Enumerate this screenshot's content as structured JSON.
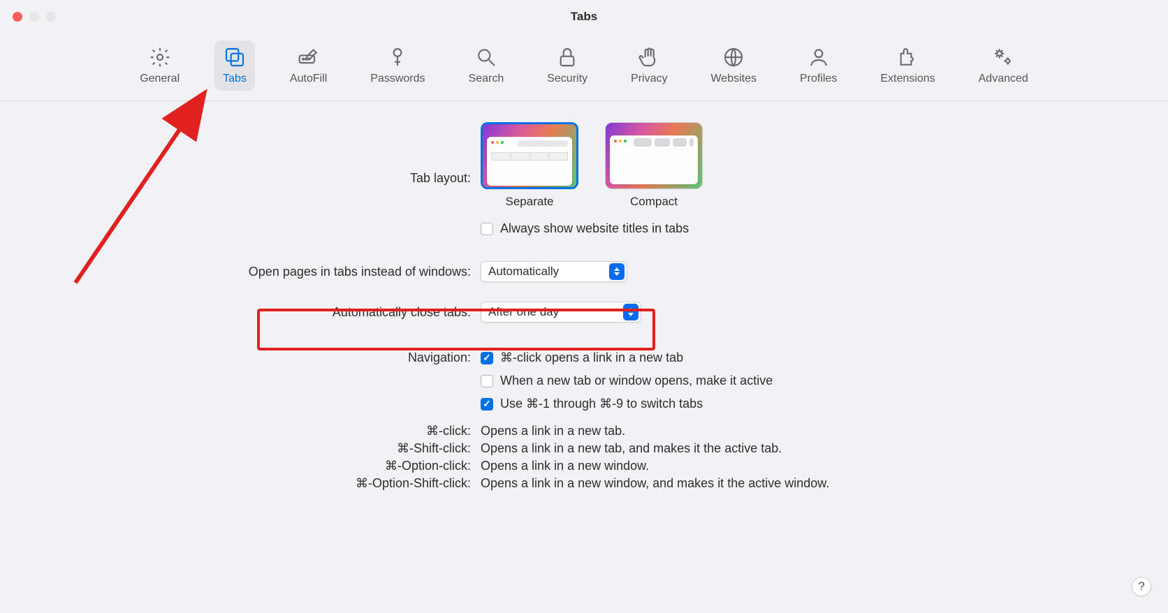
{
  "window": {
    "title": "Tabs"
  },
  "toolbar": {
    "items": [
      {
        "label": "General"
      },
      {
        "label": "Tabs",
        "selected": true
      },
      {
        "label": "AutoFill"
      },
      {
        "label": "Passwords"
      },
      {
        "label": "Search"
      },
      {
        "label": "Security"
      },
      {
        "label": "Privacy"
      },
      {
        "label": "Websites"
      },
      {
        "label": "Profiles"
      },
      {
        "label": "Extensions"
      },
      {
        "label": "Advanced"
      }
    ]
  },
  "tabLayout": {
    "label": "Tab layout:",
    "options": {
      "separate": "Separate",
      "compact": "Compact"
    },
    "alwaysShowTitles": {
      "label": "Always show website titles in tabs",
      "checked": false
    }
  },
  "openPages": {
    "label": "Open pages in tabs instead of windows:",
    "value": "Automatically"
  },
  "autoClose": {
    "label": "Automatically close tabs:",
    "value": "After one day"
  },
  "navigation": {
    "label": "Navigation:",
    "cmdClick": {
      "label": "⌘-click opens a link in a new tab",
      "checked": true
    },
    "newTabActive": {
      "label": "When a new tab or window opens, make it active",
      "checked": false
    },
    "cmdNumSwitch": {
      "label": "Use ⌘-1 through ⌘-9 to switch tabs",
      "checked": true
    }
  },
  "shortcuts": [
    {
      "key": "⌘-click:",
      "desc": "Opens a link in a new tab."
    },
    {
      "key": "⌘-Shift-click:",
      "desc": "Opens a link in a new tab, and makes it the active tab."
    },
    {
      "key": "⌘-Option-click:",
      "desc": "Opens a link in a new window."
    },
    {
      "key": "⌘-Option-Shift-click:",
      "desc": "Opens a link in a new window, and makes it the active window."
    }
  ],
  "help": "?"
}
